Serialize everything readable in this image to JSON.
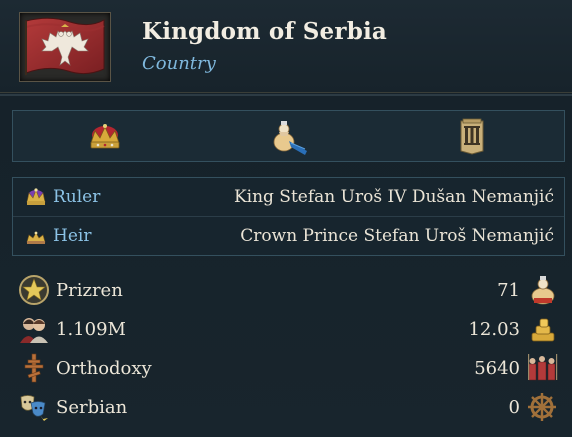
{
  "header": {
    "title": "Kingdom of Serbia",
    "subtitle": "Country",
    "flag_icon": "serbian-eagle-flag"
  },
  "tabs": [
    {
      "icon": "crown-icon"
    },
    {
      "icon": "pawn-flag-icon"
    },
    {
      "icon": "roman-numeral-three-icon"
    }
  ],
  "ruler": {
    "label": "Ruler",
    "value": "King Stefan Uroš IV Dušan Nemanjić",
    "icon": "king-crown-icon"
  },
  "heir": {
    "label": "Heir",
    "value": "Crown Prince Stefan Uroš Nemanjić",
    "icon": "prince-crown-icon"
  },
  "stats": [
    {
      "label": "Prizren",
      "value": "71",
      "icon": "capital-star-icon",
      "right_icon": "pawn-money-icon"
    },
    {
      "label": "1.109M",
      "value": "12.03",
      "icon": "population-icon",
      "right_icon": "gold-coins-icon"
    },
    {
      "label": "Orthodoxy",
      "value": "5640",
      "icon": "orthodox-cross-icon",
      "right_icon": "army-soldiers-icon"
    },
    {
      "label": "Serbian",
      "value": "0",
      "icon": "culture-masks-icon",
      "right_icon": "ship-wheel-icon"
    }
  ],
  "colors": {
    "background": "#18252d",
    "accent": "#7fb8dd",
    "text": "#ece6d8"
  }
}
